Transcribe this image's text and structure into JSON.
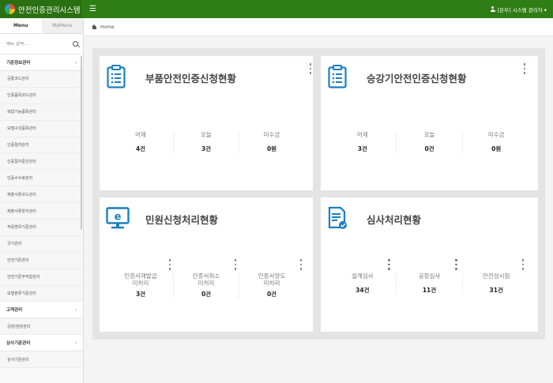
{
  "app": {
    "title": "안전인증관리시스템"
  },
  "header": {
    "user_label": "[본부] 시스템 관리자 ▾"
  },
  "sidebar": {
    "tabs": [
      {
        "label": "Menu"
      },
      {
        "label": "MyMenu"
      }
    ],
    "search_placeholder": "메뉴 검색...",
    "items": [
      {
        "label": "기준정보관리",
        "group": true,
        "chevron": "‹"
      },
      {
        "label": "공통코드관리"
      },
      {
        "label": "인증품목코드관리"
      },
      {
        "label": "복합기능품목관리"
      },
      {
        "label": "모델구성품목관리"
      },
      {
        "label": "인증절차관리"
      },
      {
        "label": "인증절차증선관리"
      },
      {
        "label": "인증수수료관리"
      },
      {
        "label": "제출서류코드관리"
      },
      {
        "label": "제출서류양식관리"
      },
      {
        "label": "적용범위기준관리"
      },
      {
        "label": "국가관리"
      },
      {
        "label": "안전기준관리"
      },
      {
        "label": "안전기준부적합관리"
      },
      {
        "label": "모델분류기준관리"
      },
      {
        "label": "고객관리",
        "group": true,
        "chevron": "‹"
      },
      {
        "label": "공장/현장관리"
      },
      {
        "label": "심사기준관리",
        "group": true,
        "chevron": "‹"
      },
      {
        "label": "심사기준관리"
      }
    ]
  },
  "breadcrumb": {
    "home": "Home"
  },
  "dashboard": {
    "cards": [
      {
        "title": "부품안전인증신청현황",
        "icon": "clipboard-list-icon",
        "stats": [
          {
            "label": "어제",
            "value": "4건"
          },
          {
            "label": "오늘",
            "value": "3건"
          },
          {
            "label": "미수금",
            "value": "0원"
          }
        ]
      },
      {
        "title": "승강기안전인증신청현황",
        "icon": "clipboard-list-icon",
        "stats": [
          {
            "label": "어제",
            "value": "3건"
          },
          {
            "label": "오늘",
            "value": "0건"
          },
          {
            "label": "미수금",
            "value": "0원"
          }
        ]
      },
      {
        "title": "민원신청처리현황",
        "icon": "monitor-e-icon",
        "stats": [
          {
            "label": "인증서재발급\n미처리",
            "value": "3건"
          },
          {
            "label": "인증서취소\n미처리",
            "value": "0건"
          },
          {
            "label": "인증서양도\n미처리",
            "value": "0건"
          }
        ]
      },
      {
        "title": "심사처리현황",
        "icon": "document-check-icon",
        "stats": [
          {
            "label": "설계심사",
            "value": "34건"
          },
          {
            "label": "공장심사",
            "value": "11건"
          },
          {
            "label": "안전성시험",
            "value": "31건"
          }
        ]
      }
    ]
  },
  "colors": {
    "header_bg": "#2f7d15",
    "accent_blue": "#1a7fc1"
  }
}
